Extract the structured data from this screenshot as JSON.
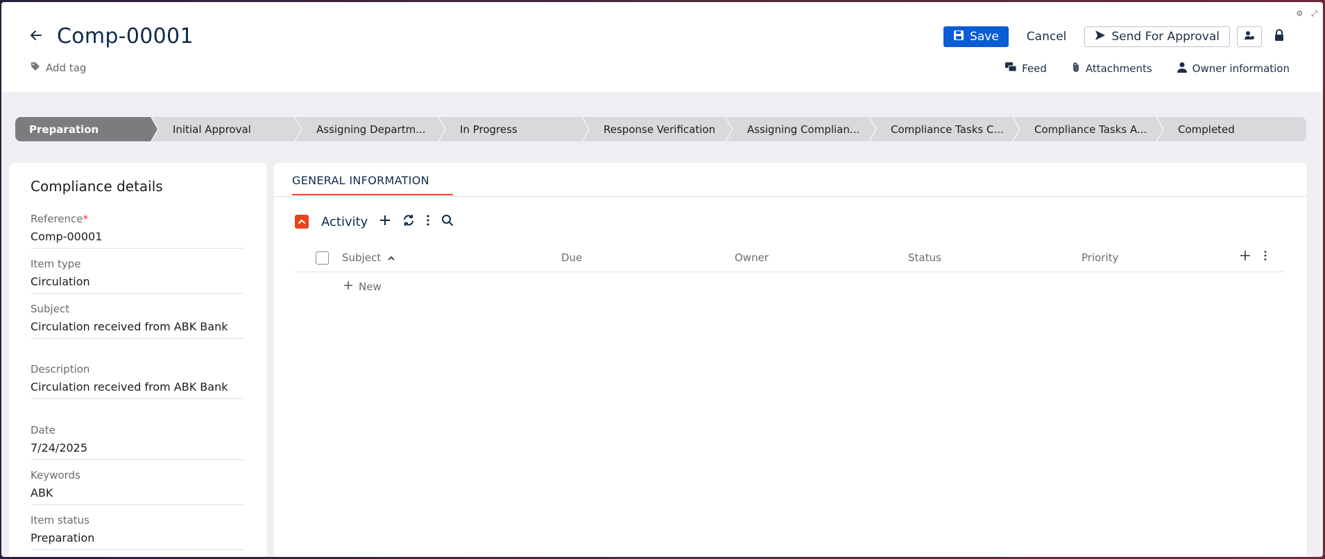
{
  "header": {
    "title": "Comp-00001",
    "add_tag": "Add tag",
    "save": "Save",
    "cancel": "Cancel",
    "send_for_approval": "Send For Approval",
    "links": {
      "feed": "Feed",
      "attachments": "Attachments",
      "owner_info": "Owner information"
    }
  },
  "stages": [
    "Preparation",
    "Initial Approval",
    "Assigning Departm...",
    "In Progress",
    "Response Verification",
    "Assigning Complian...",
    "Compliance Tasks C...",
    "Compliance Tasks A...",
    "Completed"
  ],
  "active_stage": "Preparation",
  "details": {
    "title": "Compliance details",
    "reference_label": "Reference",
    "reference_value": "Comp-00001",
    "item_type_label": "Item type",
    "item_type_value": "Circulation",
    "subject_label": "Subject",
    "subject_value": "Circulation received from ABK Bank",
    "description_label": "Description",
    "description_value": "Circulation received from ABK Bank",
    "date_label": "Date",
    "date_value": "7/24/2025",
    "keywords_label": "Keywords",
    "keywords_value": "ABK",
    "item_status_label": "Item status",
    "item_status_value": "Preparation"
  },
  "main": {
    "tab": "GENERAL INFORMATION",
    "activity_title": "Activity",
    "columns": {
      "subject": "Subject",
      "due": "Due",
      "owner": "Owner",
      "status": "Status",
      "priority": "Priority"
    },
    "new_label": "New"
  },
  "colors": {
    "accent": "#e0451f",
    "primary": "#0b5cd7",
    "active_stage": "#7c7c7e"
  }
}
